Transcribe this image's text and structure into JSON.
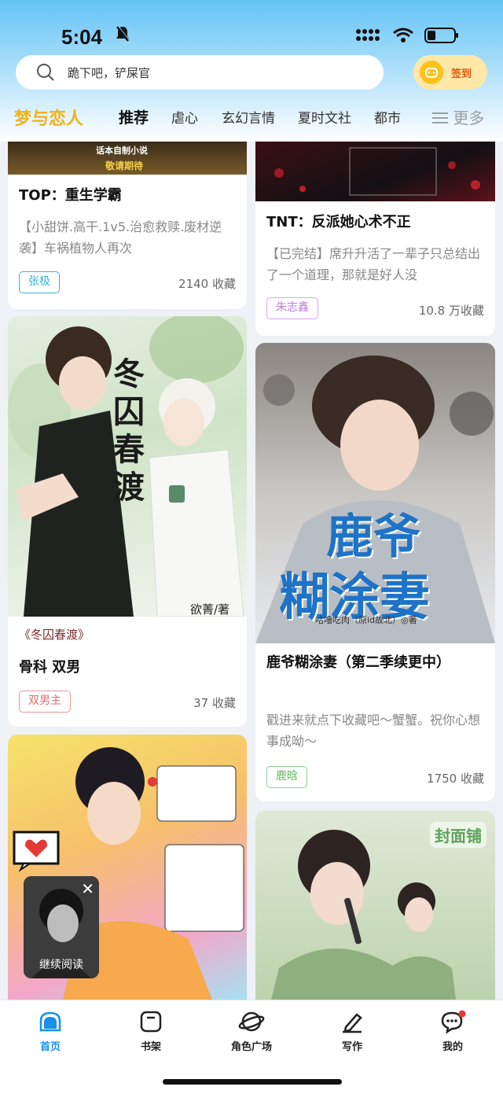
{
  "status": {
    "time": "5:04"
  },
  "search": {
    "placeholder": "跪下吧，铲屎官"
  },
  "checkin": {
    "label": "签到"
  },
  "tabs": [
    "梦与恋人",
    "推荐",
    "虐心",
    "玄幻言情",
    "夏时文社",
    "都市",
    "更多"
  ],
  "cards": {
    "c1": {
      "cover_text_1": "话本自制小说",
      "cover_text_2": "敬请期待",
      "title": "TOP：重生学霸",
      "desc": "【小甜饼.高干.1v5.治愈救赎.废材逆袭】车祸植物人再次",
      "tag": "张极",
      "count": "2140 收藏"
    },
    "c2": {
      "title": "TNT：反派她心术不正",
      "desc": "【已完结】席升升活了一辈子只总结出了一个道理，那就是好人没",
      "tag": "朱志鑫",
      "count": "10.8 万收藏"
    },
    "c3": {
      "cover_title": "冬囚春渡",
      "cover_author": "欲菁/著",
      "subtitle": "《冬囚春渡》",
      "title": "骨科 双男",
      "tag": "双男主",
      "count": "37 收藏"
    },
    "c4": {
      "cover_title_1": "鹿爷",
      "cover_title_2": "糊涂妻",
      "cover_author": "咕噜吃肉（原id故北）◎著",
      "title": "鹿爷糊涂妻（第二季续更中）",
      "desc": "戳进来就点下收藏吧～蟹蟹。祝你心想事成呦～",
      "tag": "鹿晗",
      "count": "1750 收藏"
    },
    "c6": {
      "cover_badge": "封面铺"
    }
  },
  "float_reader": {
    "label": "继续阅读"
  },
  "bottom_nav": [
    "首页",
    "书架",
    "角色广场",
    "写作",
    "我的"
  ],
  "colors": {
    "accent": "#1a8fe8",
    "brand": "#f1b21b",
    "tag_blue": "#3ab2d6",
    "tag_purple": "#c07ad8",
    "tag_red": "#e06d6d",
    "tag_green": "#5cb85c"
  }
}
